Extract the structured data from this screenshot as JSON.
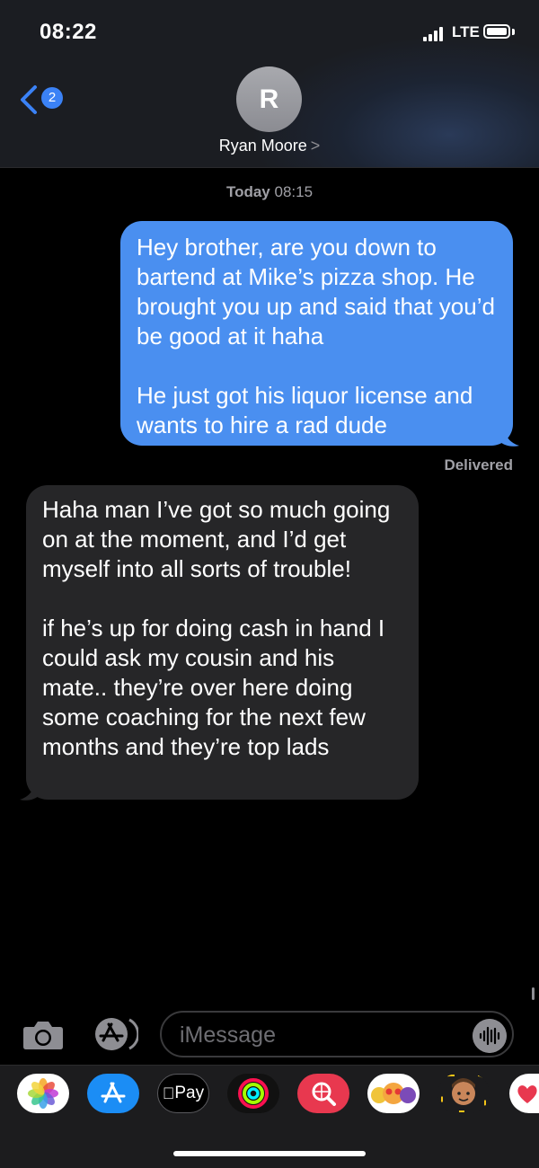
{
  "status_bar": {
    "time": "08:22",
    "network": "LTE"
  },
  "header": {
    "back_badge_count": "2",
    "avatar_initial": "R",
    "contact_name": "Ryan Moore",
    "contact_chevron": ">"
  },
  "conversation": {
    "timestamp_day": "Today",
    "timestamp_time": "08:15",
    "messages": [
      {
        "direction": "outgoing",
        "text": "Hey brother, are you down to bartend at Mike’s pizza shop. He brought you up and said that you’d be good at it haha\n\nHe just got his liquor license and wants to hire a rad dude"
      },
      {
        "direction": "incoming",
        "text": "Haha man I’ve got so much going on at the moment, and I’d get myself into all sorts of trouble!\n\nif he’s up for doing cash in hand I could ask my cousin and his mate.. they’re over here doing some coaching for the next few months and they’re top lads"
      }
    ],
    "delivery_status": "Delivered"
  },
  "input": {
    "placeholder": "iMessage"
  },
  "app_drawer": {
    "apple_pay_label": "Pay",
    "icons": [
      "photos-icon",
      "app-store-icon",
      "apple-pay-icon",
      "activity-icon",
      "image-search-icon",
      "animoji-icon",
      "memoji-icon",
      "digital-touch-icon"
    ]
  },
  "colors": {
    "outgoing_bubble": "#4a8ff0",
    "incoming_bubble": "#262628",
    "background": "#000000",
    "accent": "#3b82f6"
  }
}
